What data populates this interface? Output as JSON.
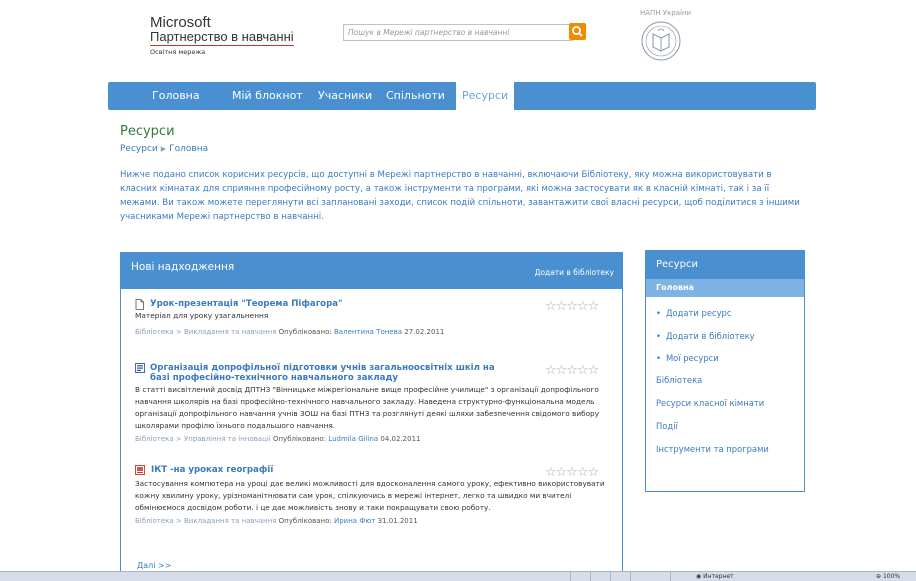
{
  "header": {
    "logo_top": "Microsoft",
    "logo_main": "Партнерство в навчанні",
    "logo_sub": "Освітня мережа",
    "search_placeholder": "Пошук в Мережі партнерство в навчанні",
    "napn_label": "НАПН України"
  },
  "nav": {
    "items": [
      "Головна",
      "Мій блокнот",
      "Учасники",
      "Спільноти",
      "Ресурси"
    ]
  },
  "page": {
    "title": "Ресурси",
    "breadcrumb": [
      "Ресурси",
      "Головна"
    ],
    "intro": "Нижче подано список корисних ресурсів, що доступні в Мережі партнерство в навчанні, включаючи Бібліотеку, яку можна використовувати в класних кімнатах для сприяння професійному росту, а також інструменти та програми, які можна застосувати як в класній кімнаті, так і за її межами. Ви також можете переглянути всі заплановані заходи, список подій спільноти, завантажити свої власні ресурси, щоб поділитися з іншими учасниками Мережі партнерство в навчанні."
  },
  "new_items": {
    "title": "Нові надходження",
    "add_link": "Додати в бібліотеку",
    "items": [
      {
        "title": "Урок-презентація \"Теорема Піфагора\"",
        "desc": "Матеріал для уроку узагальнення",
        "path": "Бібліотека > Викладання та навчання",
        "published_label": "Опубліковано:",
        "author": "Валентина Тонева",
        "date": "27.02.2011"
      },
      {
        "title": "Організація допрофільної підготовки учнів загальноосвітніх шкіл на базі професійно-технічного навчального закладу",
        "desc": "В статті висвітлений досвід ДПТНЗ \"Вінницьке міжрегіональне вище професійне училище\" з організації допрофільного навчання школярів на базі професійно-технічного навчального закладу. Наведена структурно-функціональна модель організації допрофільного навчання учнів ЗОШ на базі ПТНЗ та розглянуті деякі шляхи забезпечення свідомого вибору школярами профілю їхнього подальшого навчання.",
        "path": "Бібліотека > Управління та інновації",
        "published_label": "Опубліковано:",
        "author": "Ludmila Gilina",
        "date": "04.02.2011"
      },
      {
        "title": "ІКТ -на уроках географії",
        "desc": "Застосування компютера на уроці дає великі можливості для вдосконалення самого уроку, ефективно використовувати кожну хвилину уроку, урізноманітнювати сам урок, спілкуючись в мережі інтернет, легко та швидко ми вчителі обмінюємося досвідом роботи. і це дає можливість знову и таки покращувати свою роботу.",
        "path": "Бібліотека > Викладання та навчання",
        "published_label": "Опубліковано:",
        "author": "Ирина Фют",
        "date": "31.01.2011"
      }
    ],
    "stars": "☆☆☆☆☆",
    "more": "Далі >>"
  },
  "side": {
    "title": "Ресурси",
    "active": "Головна",
    "sub_items": [
      "Додати ресурс",
      "Додати в бібліотеку",
      "Мої ресурси"
    ],
    "items": [
      "Бібліотека",
      "Ресурси класної кімнати",
      "Події",
      "Інструменти та програми"
    ]
  },
  "status_bar": {
    "zone": "Интернет",
    "zoom": "100%"
  },
  "colors": {
    "accent": "#4a90d0",
    "link": "#3a7bbf",
    "title_green": "#2f7c3a",
    "search_button": "#f08a00"
  }
}
